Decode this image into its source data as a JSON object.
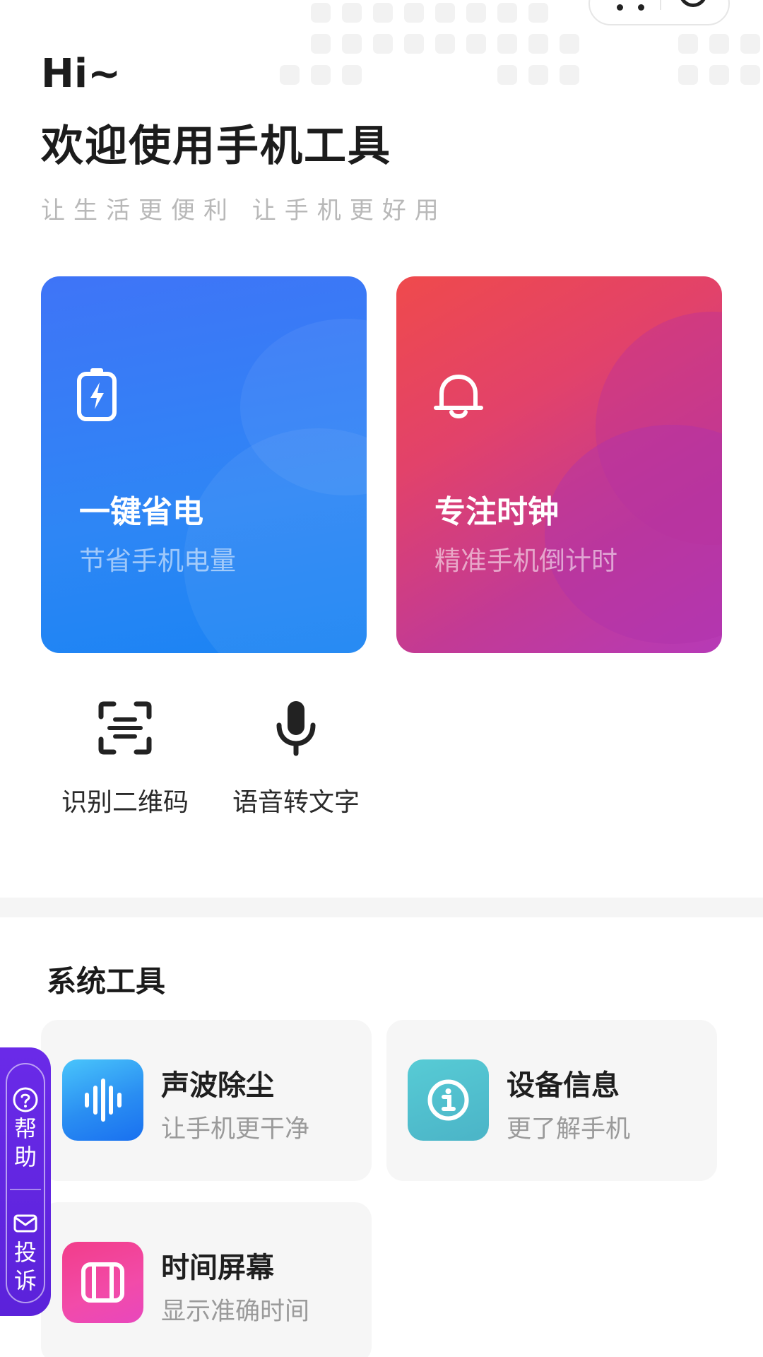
{
  "header": {
    "greeting": "Hi~",
    "title": "欢迎使用手机工具",
    "subtitle": "让生活更便利  让手机更好用"
  },
  "feature_cards": [
    {
      "title": "一键省电",
      "subtitle": "节省手机电量",
      "icon": "battery-charge-icon",
      "color": "#3f74f7"
    },
    {
      "title": "专注时钟",
      "subtitle": "精准手机倒计时",
      "icon": "bell-icon",
      "color": "#ef4a4c"
    }
  ],
  "quick_tools": [
    {
      "label": "识别二维码",
      "icon": "scan-icon"
    },
    {
      "label": "语音转文字",
      "icon": "microphone-icon"
    }
  ],
  "system_tools": {
    "title": "系统工具",
    "items": [
      {
        "title": "声波除尘",
        "subtitle": "让手机更干净",
        "icon": "sound-wave-icon",
        "color": "#2a8ef2"
      },
      {
        "title": "设备信息",
        "subtitle": "更了解手机",
        "icon": "info-icon",
        "color": "#4bb4c7"
      },
      {
        "title": "时间屏幕",
        "subtitle": "显示准确时间",
        "icon": "screen-icon",
        "color": "#f24ba9"
      }
    ]
  },
  "side_tab": {
    "help": "帮助",
    "complain": "投诉"
  }
}
